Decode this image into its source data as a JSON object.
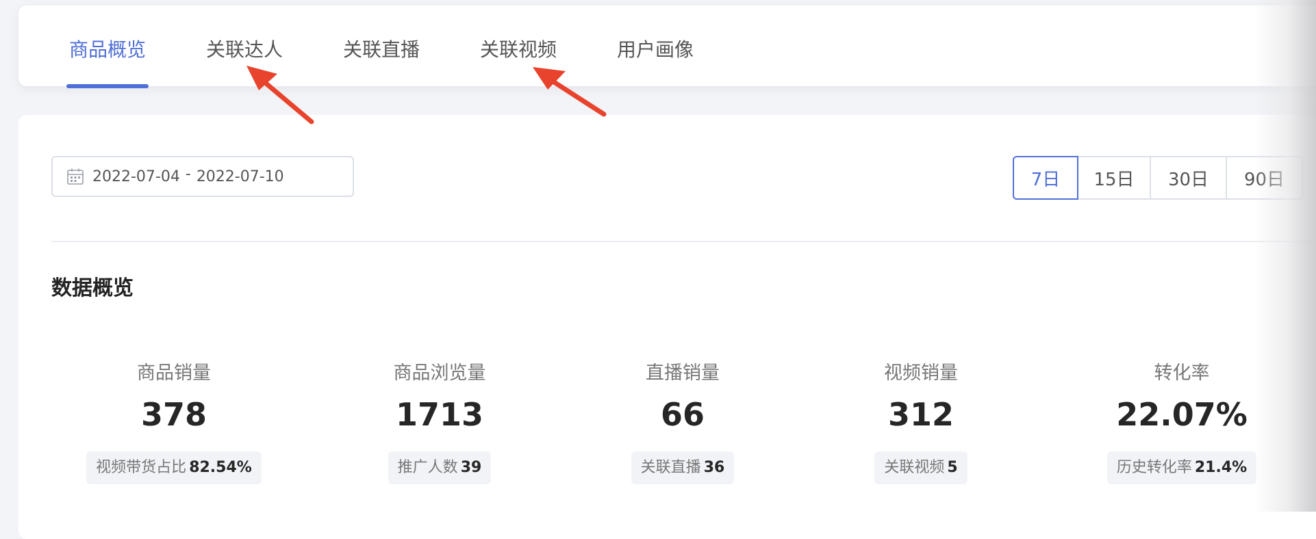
{
  "tabs": [
    {
      "label": "商品概览",
      "active": true
    },
    {
      "label": "关联达人",
      "active": false
    },
    {
      "label": "关联直播",
      "active": false
    },
    {
      "label": "关联视频",
      "active": false
    },
    {
      "label": "用户画像",
      "active": false
    }
  ],
  "date_range": {
    "start": "2022-07-04",
    "separator": "-",
    "end": "2022-07-10"
  },
  "range_options": [
    {
      "label": "7日",
      "active": true
    },
    {
      "label": "15日",
      "active": false
    },
    {
      "label": "30日",
      "active": false
    },
    {
      "label": "90日",
      "active": false
    }
  ],
  "overview": {
    "title": "数据概览",
    "metrics": [
      {
        "label": "商品销量",
        "value": "378",
        "sub_label": "视频带货占比",
        "sub_value": "82.54%"
      },
      {
        "label": "商品浏览量",
        "value": "1713",
        "sub_label": "推广人数",
        "sub_value": "39"
      },
      {
        "label": "直播销量",
        "value": "66",
        "sub_label": "关联直播",
        "sub_value": "36"
      },
      {
        "label": "视频销量",
        "value": "312",
        "sub_label": "关联视频",
        "sub_value": "5"
      },
      {
        "label": "转化率",
        "value": "22.07%",
        "sub_label": "历史转化率",
        "sub_value": "21.4%"
      }
    ]
  },
  "colors": {
    "accent": "#4f6fd6",
    "annotation_arrow": "#e8432c"
  },
  "icons": [
    "calendar-icon"
  ]
}
